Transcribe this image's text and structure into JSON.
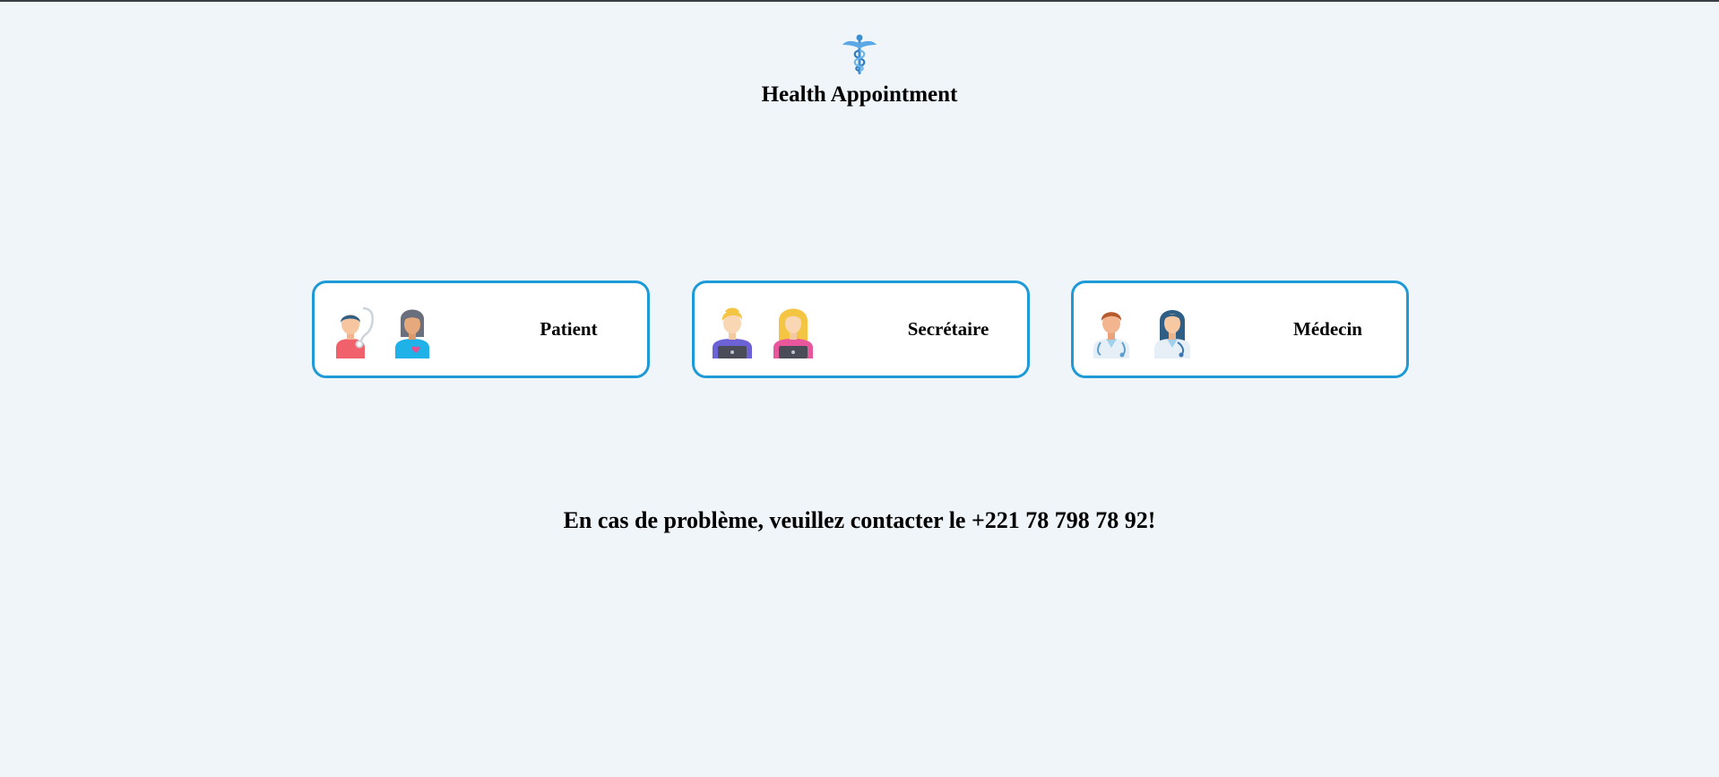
{
  "app": {
    "title": "Health Appointment",
    "logo_icon": "caduceus-icon"
  },
  "roles": [
    {
      "label": "Patient",
      "icons": [
        "patient-man-icon",
        "patient-woman-icon"
      ]
    },
    {
      "label": "Secrétaire",
      "icons": [
        "secretary-man-icon",
        "secretary-woman-icon"
      ]
    },
    {
      "label": "Médecin",
      "icons": [
        "doctor-man-icon",
        "doctor-woman-icon"
      ]
    }
  ],
  "contact": {
    "message": "En cas de problème, veuillez contacter le +221 78 798 78 92!"
  },
  "colors": {
    "background": "#eff5f8",
    "card_border": "#1e9ad6",
    "card_background": "#ffffff",
    "logo": "#3f8fd2"
  }
}
